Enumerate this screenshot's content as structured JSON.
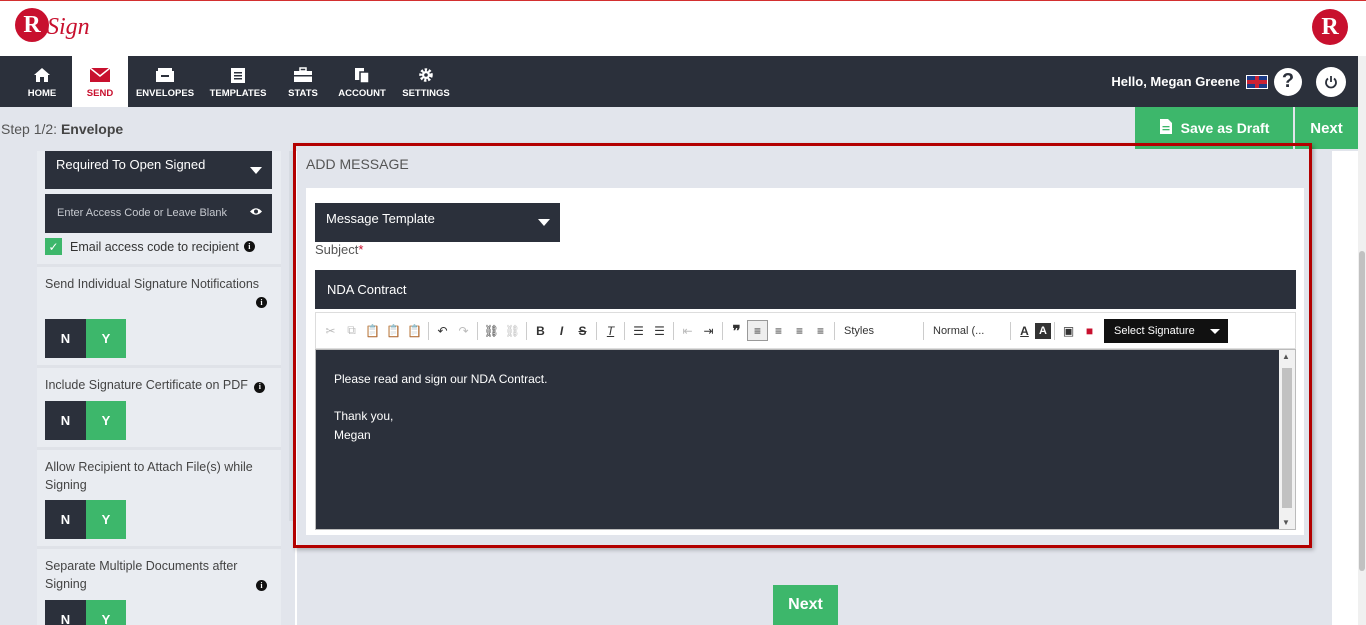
{
  "app": {
    "logo_letter": "R",
    "logo_text": "Sign",
    "logo_right_letter": "R"
  },
  "nav": {
    "items": [
      {
        "label": "HOME",
        "icon": "home-icon"
      },
      {
        "label": "SEND",
        "icon": "envelope-icon"
      },
      {
        "label": "ENVELOPES",
        "icon": "inbox-icon"
      },
      {
        "label": "TEMPLATES",
        "icon": "templates-icon"
      },
      {
        "label": "STATS",
        "icon": "briefcase-icon"
      },
      {
        "label": "ACCOUNT",
        "icon": "documents-icon"
      },
      {
        "label": "SETTINGS",
        "icon": "gear-icon"
      }
    ],
    "greeting": "Hello, Megan Greene"
  },
  "step": {
    "prefix": "Step 1/2:",
    "name": "Envelope"
  },
  "actions": {
    "save_draft": "Save as Draft",
    "next_top": "Next",
    "next_bottom": "Next"
  },
  "left": {
    "access_dropdown": "Required To Open Signed",
    "access_code_placeholder": "Enter Access Code or Leave Blank",
    "email_access_code": "Email access code to recipient",
    "options": [
      {
        "label": "Send Individual Signature Notifications",
        "n": "N",
        "y": "Y"
      },
      {
        "label": "Include Signature Certificate on PDF",
        "n": "N",
        "y": "Y"
      },
      {
        "label": "Allow Recipient to Attach File(s) while Signing",
        "n": "N",
        "y": "Y"
      },
      {
        "label": "Separate Multiple Documents after Signing",
        "n": "N",
        "y": "Y"
      }
    ]
  },
  "message": {
    "header": "ADD MESSAGE",
    "template_dropdown": "Message Template",
    "subject_label": "Subject",
    "subject_required": "*",
    "subject_value": "NDA Contract",
    "toolbar": {
      "styles": "Styles",
      "format": "Normal (...",
      "select_signature": "Select Signature"
    },
    "body_lines": [
      "Please read and sign our NDA Contract.",
      "",
      "Thank you,",
      "Megan"
    ]
  },
  "colors": {
    "accent_green": "#3db76b",
    "dark": "#2b303b",
    "brand_red": "#c8102e",
    "highlight_border": "#b30000"
  }
}
